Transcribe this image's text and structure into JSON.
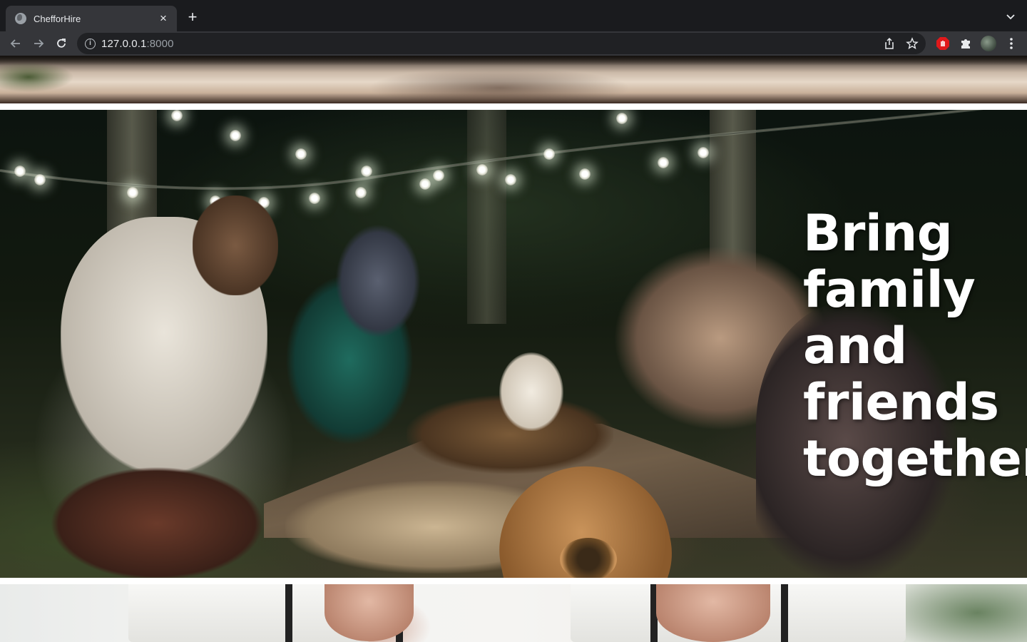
{
  "browser": {
    "tab": {
      "title": "ChefforHire",
      "close_icon": "close-icon",
      "favicon": "globe-icon"
    },
    "new_tab_icon": "plus-icon",
    "tab_search_icon": "chevron-down-icon",
    "nav": {
      "back_icon": "arrow-left-icon",
      "forward_icon": "arrow-right-icon",
      "reload_icon": "reload-icon"
    },
    "address": {
      "host": "127.0.0.1",
      "port": ":8000",
      "security_icon": "info-icon"
    },
    "omnibox_actions": [
      "share-icon",
      "star-icon"
    ],
    "extensions": [
      "adblock-icon",
      "puzzle-icon",
      "profile-avatar",
      "kebab-menu-icon"
    ]
  },
  "page": {
    "hero": {
      "headline_lines": [
        "Bring",
        "family",
        "and",
        "friends",
        "together."
      ]
    }
  }
}
